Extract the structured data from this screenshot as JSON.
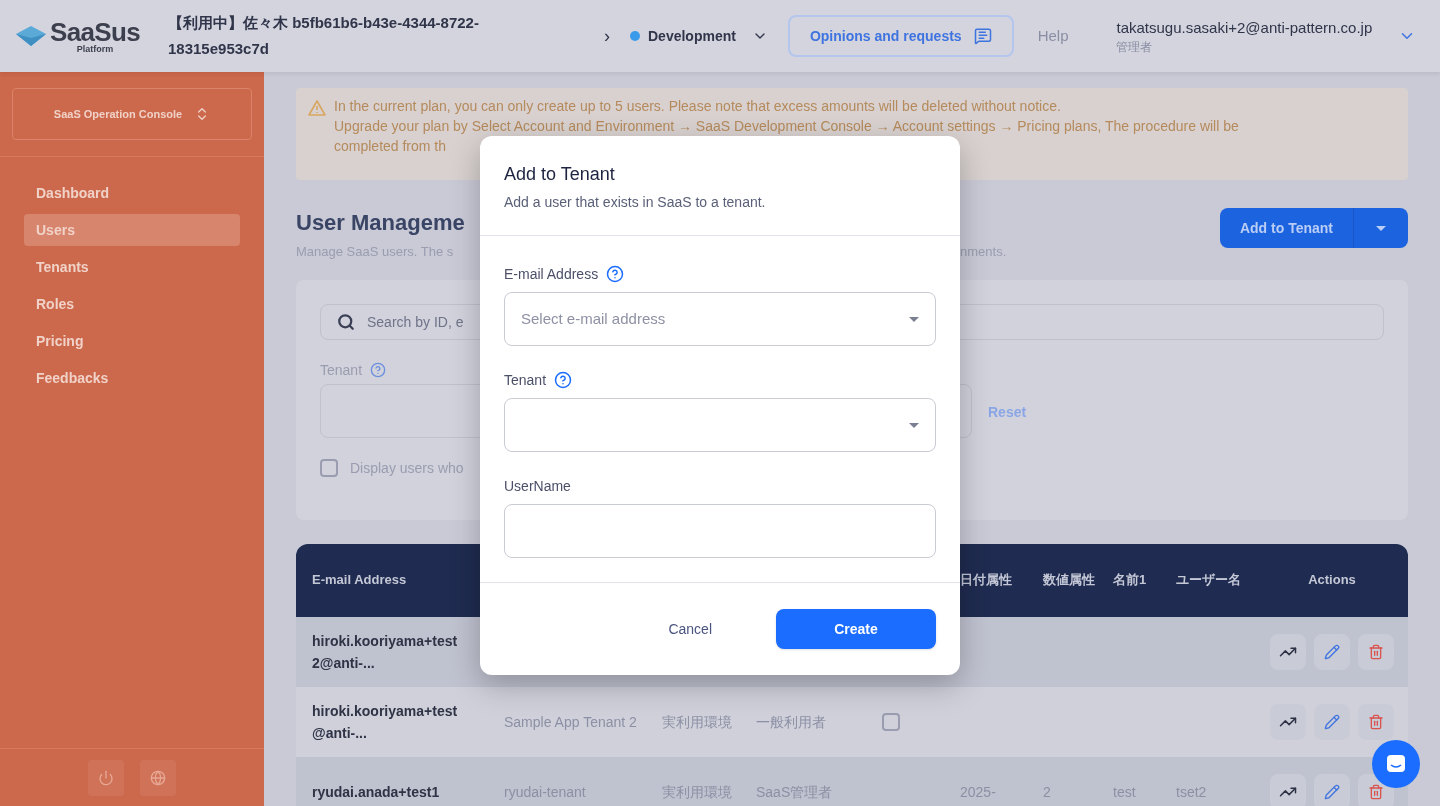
{
  "header": {
    "logo": {
      "name": "SaaSus",
      "sub": "Platform"
    },
    "env_title": "【利用中】佐々木 b5fb61b6-b43e-4344-8722-18315e953c7d",
    "breadcrumb_sep": "›",
    "environment": "Development",
    "feedback_button": "Opinions and requests",
    "help": "Help",
    "user": {
      "email": "takatsugu.sasaki+2@anti-pattern.co.jp",
      "role": "管理者"
    }
  },
  "sidebar": {
    "console": "SaaS Operation Console",
    "items": [
      {
        "label": "Dashboard",
        "selected": false
      },
      {
        "label": "Users",
        "selected": true
      },
      {
        "label": "Tenants",
        "selected": false
      },
      {
        "label": "Roles",
        "selected": false
      },
      {
        "label": "Pricing",
        "selected": false
      },
      {
        "label": "Feedbacks",
        "selected": false
      }
    ]
  },
  "banner": {
    "lines": [
      "In the current plan, you can only create up to 5 users. Please note that excess amounts will be deleted without notice.",
      "Upgrade your plan by Select Account and Environment → SaaS Development Console → Account settings → Pricing plans, The procedure will be",
      "completed from th"
    ]
  },
  "page": {
    "title": "User Manageme",
    "description": "Manage SaaS users. The s",
    "description_end": "nments.",
    "add_button": "Add to Tenant"
  },
  "filters": {
    "search_placeholder": "Search by ID, e",
    "tenant_label": "Tenant",
    "reset": "Reset",
    "checkbox": {
      "label": "Display users who",
      "checked": false
    }
  },
  "table": {
    "columns": [
      "E-mail Address",
      "日付属性",
      "数値属性",
      "名前1",
      "ユーザー名",
      "Actions"
    ],
    "rows": [
      {
        "email": "hiroki.kooriyama+test2@anti-..."
      },
      {
        "email": "hiroki.kooriyama+test@anti-...",
        "tenant": "Sample App Tenant 2",
        "environment": "実利用環境",
        "role": "一般利用者",
        "flag": {
          "checked": false
        }
      },
      {
        "email": "ryudai.anada+test1",
        "tenant": "ryudai-tenant",
        "environment": "実利用環境",
        "role": "SaaS管理者",
        "date": "2025-",
        "number": "2",
        "name": "test",
        "username": "tset2"
      }
    ]
  },
  "dialog": {
    "title": "Add to Tenant",
    "subtitle": "Add a user that exists in SaaS to a tenant.",
    "fields": [
      {
        "kind": "select",
        "label": "E-mail Address",
        "help": true,
        "placeholder": "Select e-mail address"
      },
      {
        "kind": "select",
        "label": "Tenant",
        "help": true
      },
      {
        "kind": "text",
        "label": "UserName",
        "help": false
      }
    ],
    "cancel": "Cancel",
    "submit": "Create"
  }
}
